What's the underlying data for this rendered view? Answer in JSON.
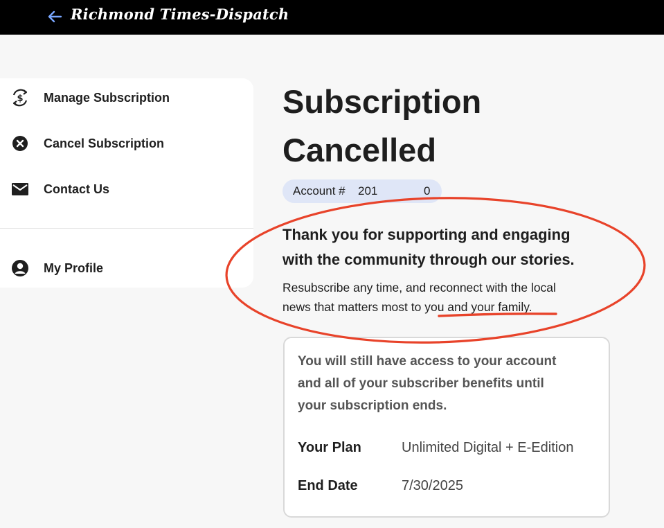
{
  "header": {
    "masthead": "Richmond Times-Dispatch",
    "background": "#000000",
    "back_icon": "arrow-left-icon",
    "back_icon_color": "#7aa7ff"
  },
  "sidebar": {
    "items": [
      {
        "label": "Manage Subscription",
        "icon": "dollar-cycle-icon"
      },
      {
        "label": "Cancel Subscription",
        "icon": "x-circle-icon"
      },
      {
        "label": "Contact Us",
        "icon": "envelope-icon"
      },
      {
        "label": "My Profile",
        "icon": "user-circle-icon"
      }
    ]
  },
  "main": {
    "title_line1": "Subscription",
    "title_line2": "Cancelled",
    "account": {
      "prefix": "Account #",
      "number": "201",
      "tail": "0",
      "pill_color": "#dfe6f7"
    },
    "thanks_line1": "Thank you for supporting and engaging",
    "thanks_line2": "with the community through our stories.",
    "resub_line1": "Resubscribe any time, and reconnect with the local",
    "resub_line2_pre": "news that matters most to ",
    "resub_line2_link": "you and your family",
    "resub_line2_post": "."
  },
  "info_card": {
    "note_line1": "You will still have access to your account",
    "note_line2": "and all of your subscriber benefits until",
    "note_line3": "your subscription ends.",
    "rows": [
      {
        "key": "Your Plan",
        "value": "Unlimited Digital + E-Edition"
      },
      {
        "key": "End Date",
        "value": "7/30/2025"
      }
    ]
  },
  "annotation": {
    "color": "#e8432a"
  }
}
